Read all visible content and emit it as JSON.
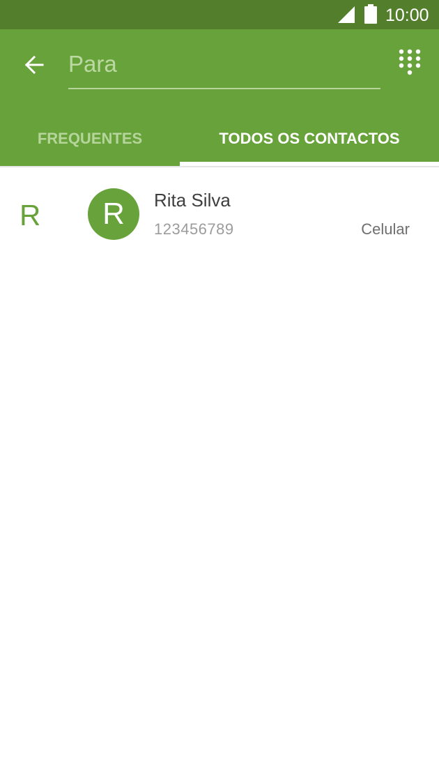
{
  "status_bar": {
    "time": "10:00",
    "icon_color": "#ffffff",
    "background": "#537f2c"
  },
  "header": {
    "back_icon": "arrow-left-icon",
    "to_placeholder": "Para",
    "dialpad_icon": "dialpad-icon",
    "background": "#68a23a"
  },
  "tabs": [
    {
      "label": "FREQUENTES",
      "selected": false
    },
    {
      "label": "TODOS OS CONTACTOS",
      "selected": true
    }
  ],
  "contacts": {
    "section_letter": "R",
    "items": [
      {
        "initial": "R",
        "name": "Rita Silva",
        "number": "123456789",
        "type": "Celular"
      }
    ]
  },
  "colors": {
    "accent": "#68a23a",
    "status_bar": "#537f2c",
    "tab_inactive": "#b5d59a"
  }
}
